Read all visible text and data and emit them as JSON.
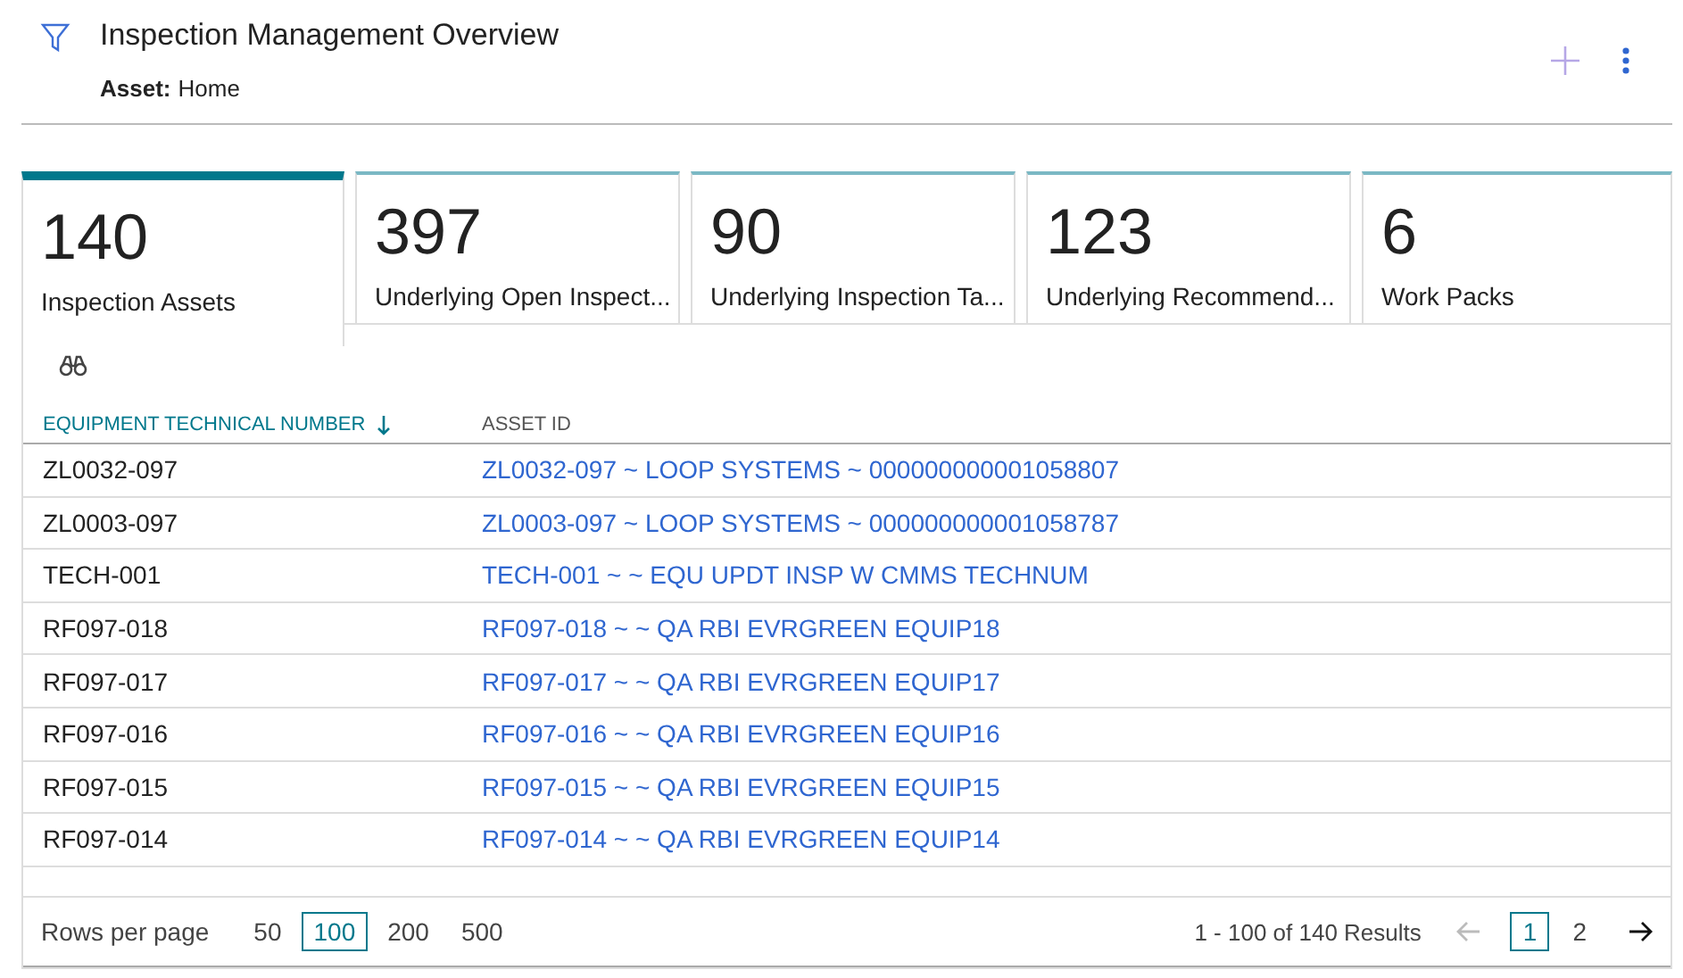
{
  "header": {
    "title": "Inspection Management Overview",
    "asset_label": "Asset:",
    "asset_value": "Home"
  },
  "tabs": [
    {
      "value": "140",
      "label": "Inspection Assets",
      "selected": true
    },
    {
      "value": "397",
      "label": "Underlying Open Inspect...",
      "selected": false
    },
    {
      "value": "90",
      "label": "Underlying Inspection Ta...",
      "selected": false
    },
    {
      "value": "123",
      "label": "Underlying Recommend...",
      "selected": false
    },
    {
      "value": "6",
      "label": "Work Packs",
      "selected": false
    }
  ],
  "table": {
    "columns": [
      {
        "label": "EQUIPMENT TECHNICAL NUMBER",
        "sorted": true
      },
      {
        "label": "ASSET ID",
        "sorted": false
      }
    ],
    "rows": [
      [
        "ZL0032-097",
        "ZL0032-097 ~ LOOP SYSTEMS ~ 000000000001058807"
      ],
      [
        "ZL0003-097",
        "ZL0003-097 ~ LOOP SYSTEMS ~ 000000000001058787"
      ],
      [
        "TECH-001",
        "TECH-001 ~ ~ EQU UPDT INSP W CMMS TECHNUM"
      ],
      [
        "RF097-018",
        "RF097-018 ~ ~ QA RBI EVRGREEN EQUIP18"
      ],
      [
        "RF097-017",
        "RF097-017 ~ ~ QA RBI EVRGREEN EQUIP17"
      ],
      [
        "RF097-016",
        "RF097-016 ~ ~ QA RBI EVRGREEN EQUIP16"
      ],
      [
        "RF097-015",
        "RF097-015 ~ ~ QA RBI EVRGREEN EQUIP15"
      ],
      [
        "RF097-014",
        "RF097-014 ~ ~ QA RBI EVRGREEN EQUIP14"
      ]
    ]
  },
  "pager": {
    "rows_label": "Rows per page",
    "sizes": [
      {
        "label": "50",
        "selected": false
      },
      {
        "label": "100",
        "selected": true
      },
      {
        "label": "200",
        "selected": false
      },
      {
        "label": "500",
        "selected": false
      }
    ],
    "summary": "1 - 100 of 140 Results",
    "pages": [
      {
        "label": "1",
        "selected": true
      },
      {
        "label": "2",
        "selected": false
      }
    ]
  }
}
